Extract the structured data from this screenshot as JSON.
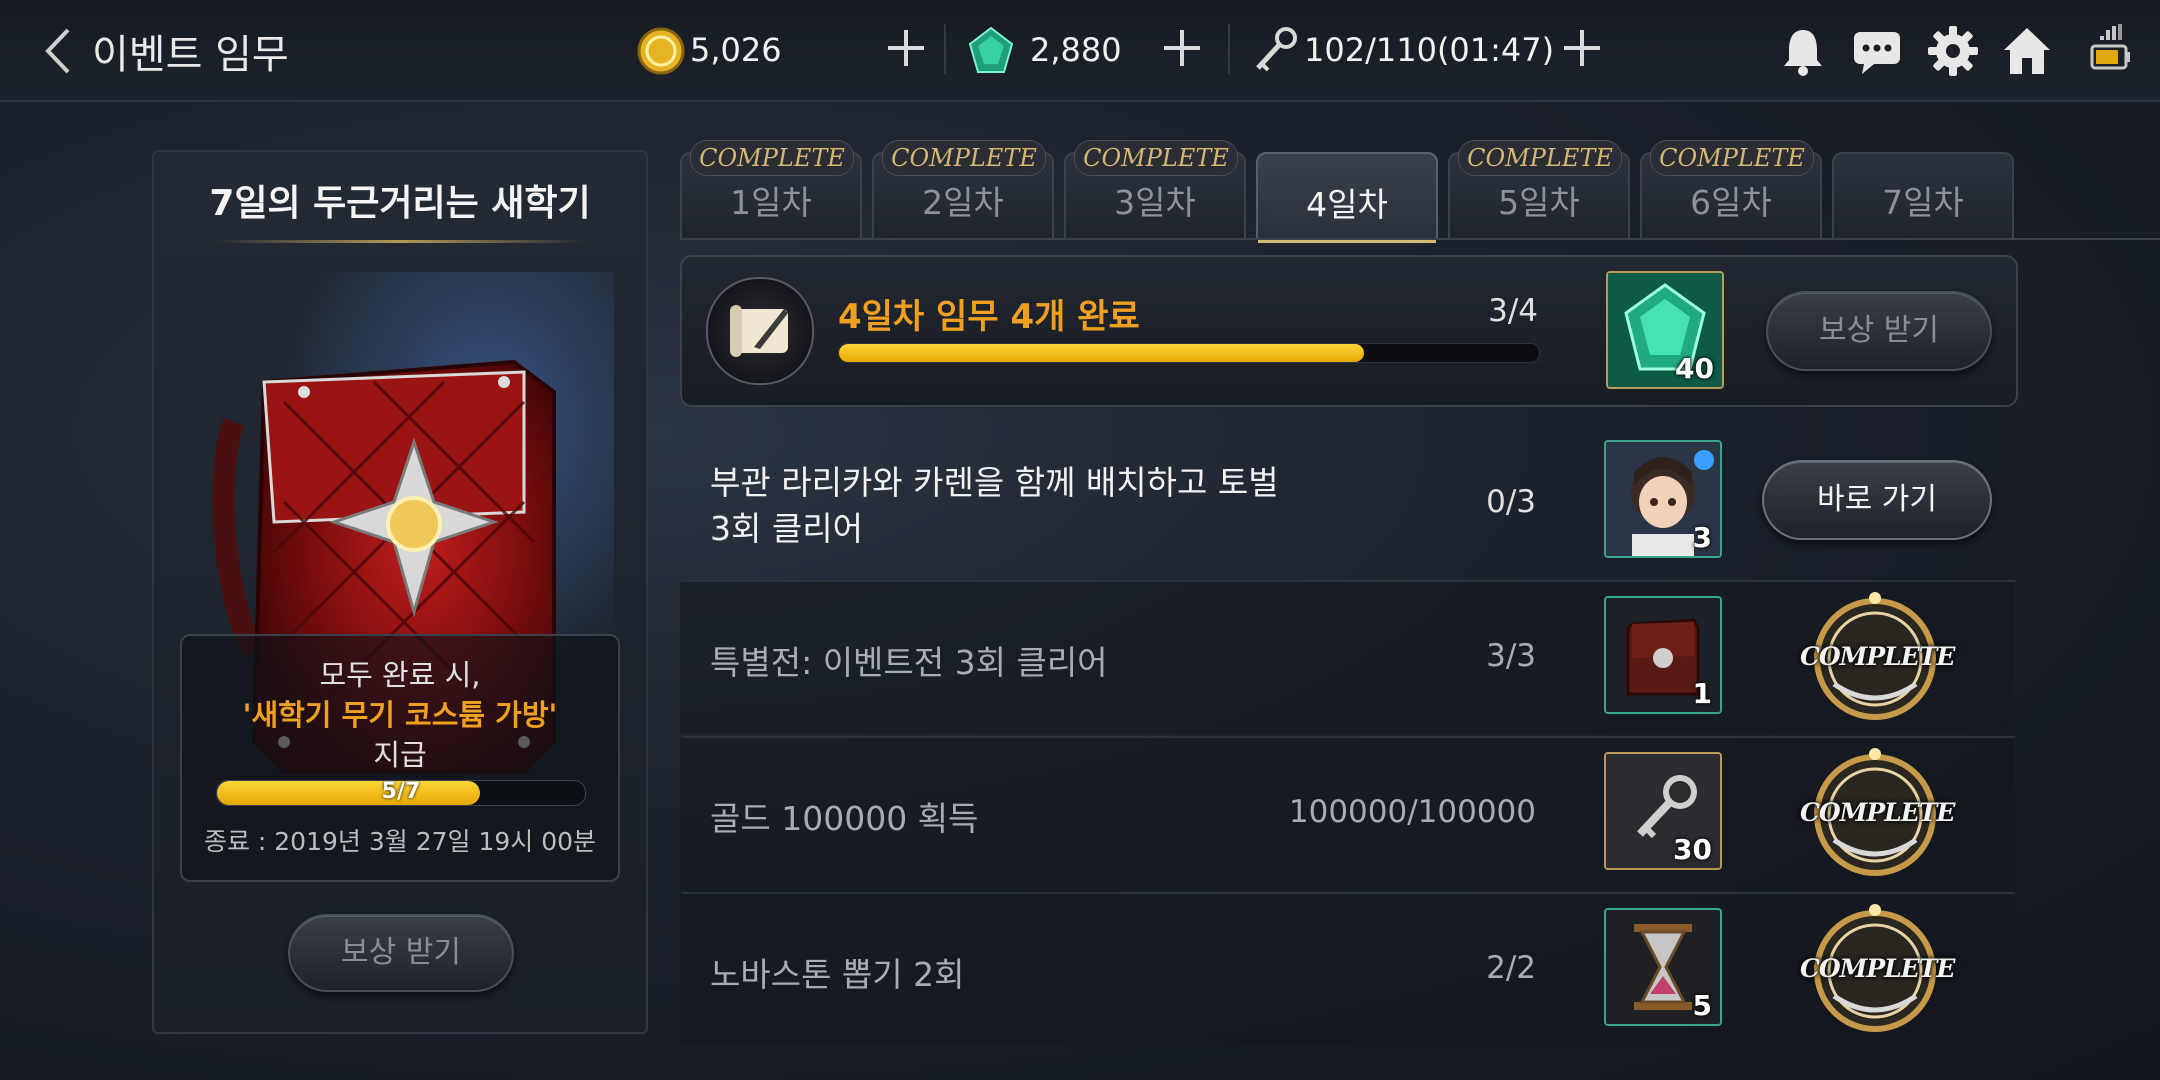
{
  "header": {
    "title": "이벤트 임무",
    "gold": "5,026",
    "gems": "2,880",
    "stamina": "102/110(01:47)"
  },
  "left_panel": {
    "title": "7일의 두근거리는 새학기",
    "reward_line1": "모두 완료 시,",
    "reward_line2": "'새학기 무기 코스튬 가방'",
    "reward_line3": "지급",
    "progress_text": "5/7",
    "progress_fraction": 0.714,
    "end_time": "종료 : 2019년 3월 27일 19시 00분",
    "claim_label": "보상 받기"
  },
  "tabs": [
    {
      "label": "1일차",
      "complete": "COMPLETE"
    },
    {
      "label": "2일차",
      "complete": "COMPLETE"
    },
    {
      "label": "3일차",
      "complete": "COMPLETE"
    },
    {
      "label": "4일차",
      "complete": ""
    },
    {
      "label": "5일차",
      "complete": "COMPLETE"
    },
    {
      "label": "6일차",
      "complete": "COMPLETE"
    },
    {
      "label": "7일차",
      "complete": ""
    }
  ],
  "summary": {
    "title": "4일차 임무 4개 완료",
    "progress": "3/4",
    "progress_fraction": 0.75,
    "reward_count": "40",
    "claim_label": "보상 받기"
  },
  "missions": [
    {
      "title_line1": "부관 라리카와 카렌을 함께 배치하고 토벌",
      "title_line2": "3회 클리어",
      "progress": "0/3",
      "reward_count": "3",
      "action": "바로 가기"
    },
    {
      "title_line1": "특별전: 이벤트전 3회 클리어",
      "progress": "3/3",
      "reward_count": "1",
      "status": "COMPLETE"
    },
    {
      "title_line1": "골드 100000 획득",
      "progress": "100000/100000",
      "reward_count": "30",
      "status": "COMPLETE"
    },
    {
      "title_line1": "노바스톤 뽑기 2회",
      "progress": "2/2",
      "reward_count": "5",
      "status": "COMPLETE"
    }
  ],
  "colors": {
    "accent": "#f0a020",
    "bar": "#f5c518",
    "complete_gold": "#d6b672"
  }
}
